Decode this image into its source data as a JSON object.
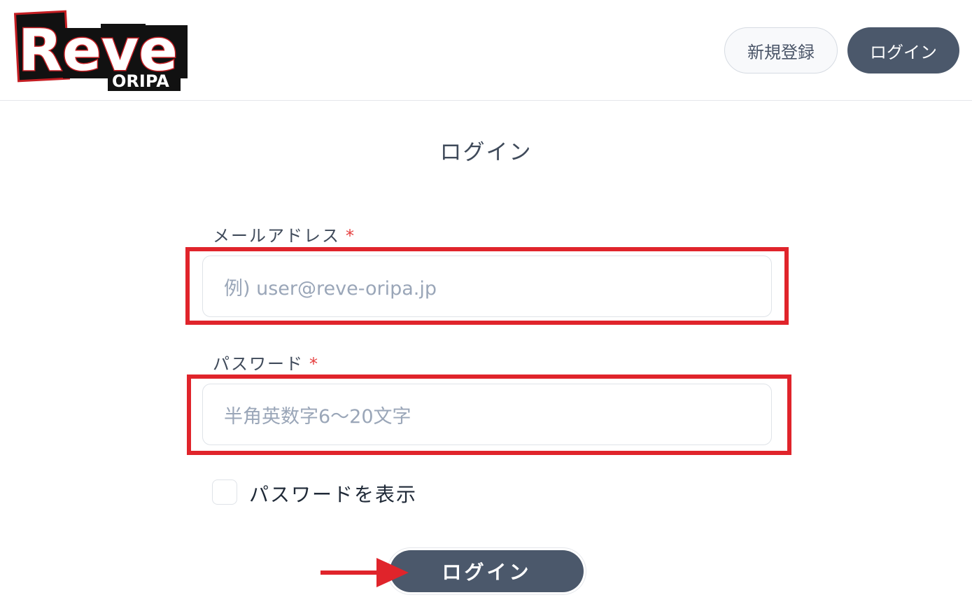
{
  "header": {
    "logo": {
      "main_text": "Reve",
      "sub_text": "ORIPA"
    },
    "register_label": "新規登録",
    "login_label": "ログイン"
  },
  "form": {
    "title": "ログイン",
    "email": {
      "label": "メールアドレス",
      "required_mark": "*",
      "value": "",
      "placeholder": "例) user@reve-oripa.jp"
    },
    "password": {
      "label": "パスワード",
      "required_mark": "*",
      "value": "",
      "placeholder": "半角英数字6〜20文字"
    },
    "show_password": {
      "label": "パスワードを表示",
      "checked": false
    },
    "submit_label": "ログイン"
  },
  "annotations": {
    "highlight_color": "#e0242b",
    "arrow_color": "#e0242b"
  },
  "colors": {
    "primary_button": "#4b586b",
    "required": "#e53e3e"
  }
}
